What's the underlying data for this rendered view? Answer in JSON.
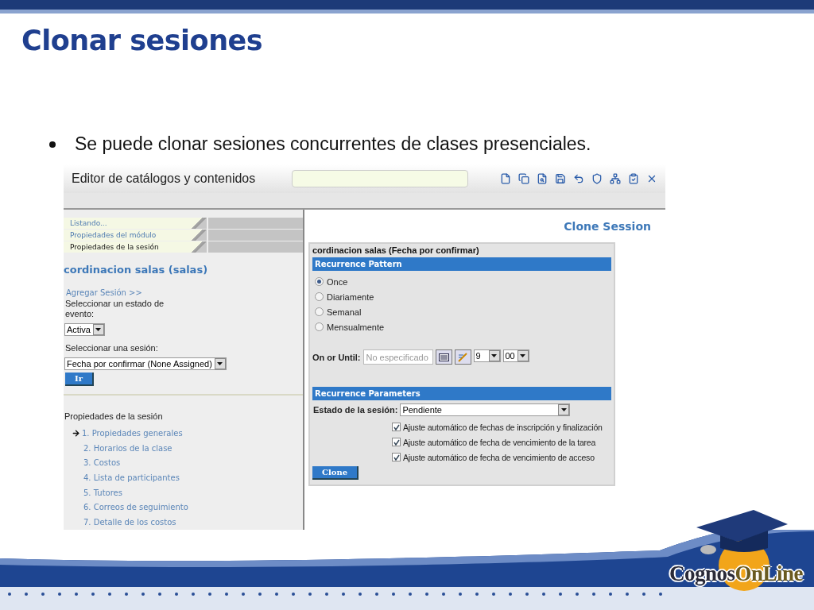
{
  "slide": {
    "title": "Clonar sesiones",
    "bullets": [
      "Se puede clonar sesiones concurrentes de clases presenciales."
    ]
  },
  "app": {
    "title": "Editor de catálogos y contenidos",
    "tabs": [
      {
        "label": "Listando...",
        "selected": false
      },
      {
        "label": "Propiedades del módulo",
        "selected": false
      },
      {
        "label": "Propiedades de la sesión",
        "selected": true
      }
    ],
    "left": {
      "heading": "cordinacion salas (salas)",
      "add_link": "Agregar Sesión >>",
      "event_status_label": "Seleccionar un estado de evento:",
      "event_status": "Activa",
      "session_label": "Seleccionar una sesión:",
      "session": "Fecha por confirmar (None Assigned)",
      "go_button": "Ir",
      "properties_title": "Propiedades de la sesión",
      "properties": [
        {
          "label": "1. Propiedades generales",
          "selected": true
        },
        {
          "label": "2. Horarios de la clase",
          "selected": false
        },
        {
          "label": "3. Costos",
          "selected": false
        },
        {
          "label": "4. Lista de participantes",
          "selected": false
        },
        {
          "label": "5. Tutores",
          "selected": false
        },
        {
          "label": "6. Correos de seguimiento",
          "selected": false
        },
        {
          "label": "7. Detalle de los costos",
          "selected": false
        }
      ]
    },
    "right": {
      "heading": "Clone Session",
      "form_title": "cordinacion salas (Fecha por confirmar)",
      "pattern_header": "Recurrence Pattern",
      "patterns": [
        {
          "label": "Once",
          "selected": true
        },
        {
          "label": "Diariamente",
          "selected": false
        },
        {
          "label": "Semanal",
          "selected": false
        },
        {
          "label": "Mensualmente",
          "selected": false
        }
      ],
      "until_label": "On or Until:",
      "until_placeholder": "No especificado",
      "hour": "9",
      "minute": "00",
      "params_header": "Recurrence Parameters",
      "status_label": "Estado de la sesión:",
      "status": "Pendiente",
      "options": [
        {
          "label": "Ajuste automático de fechas de inscripción y finalización",
          "checked": true
        },
        {
          "label": "Ajuste automático de fecha de vencimiento de la tarea",
          "checked": true
        },
        {
          "label": "Ajuste automático de fecha de vencimiento de acceso",
          "checked": true
        }
      ],
      "clone_button": "Clone"
    }
  },
  "logo": {
    "first": "Cognos",
    "second": "OnLine"
  }
}
